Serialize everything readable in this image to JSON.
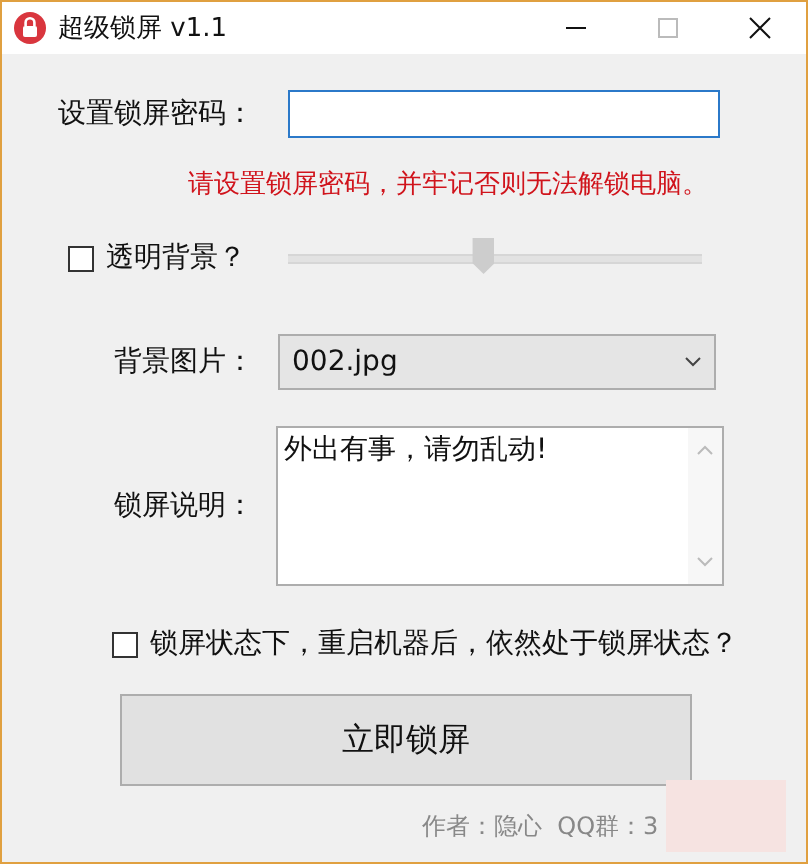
{
  "window": {
    "title": "超级锁屏 v1.1"
  },
  "password": {
    "label": "设置锁屏密码："
  },
  "warning": "请设置锁屏密码，并牢记否则无法解锁电脑。",
  "transparent": {
    "label": "透明背景？",
    "checked": false,
    "level": 0.47
  },
  "background": {
    "label": "背景图片：",
    "value": "002.jpg"
  },
  "note": {
    "label": "锁屏说明：",
    "value": "外出有事，请勿乱动!"
  },
  "persist": {
    "label": "锁屏状态下，重启机器后，依然处于锁屏状态？",
    "checked": false
  },
  "lock_button": "立即锁屏",
  "footer": "作者：隐心  QQ群：3"
}
